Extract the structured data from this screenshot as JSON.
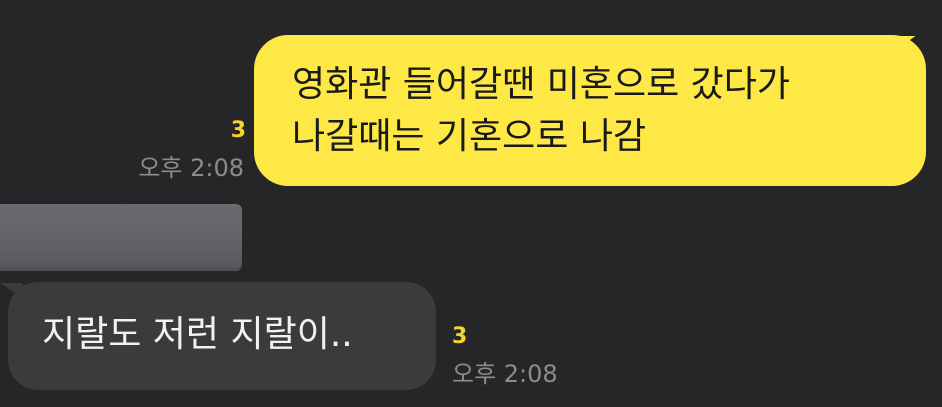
{
  "messages": {
    "outgoing": {
      "lines": [
        "영화관 들어갈땐 미혼으로 갔다가",
        "나갈때는 기혼으로 나감"
      ],
      "unread_count": "3",
      "time": "오후 2:08",
      "bubble_color": "#fde845"
    },
    "incoming_image": {
      "redacted": true
    },
    "incoming": {
      "text": "지랄도 저런 지랄이..",
      "unread_count": "3",
      "time": "오후 2:08",
      "bubble_color": "#3b3b3d"
    }
  },
  "colors": {
    "background": "#262628",
    "unread": "#f4d430",
    "timestamp": "#8c8c8e"
  }
}
